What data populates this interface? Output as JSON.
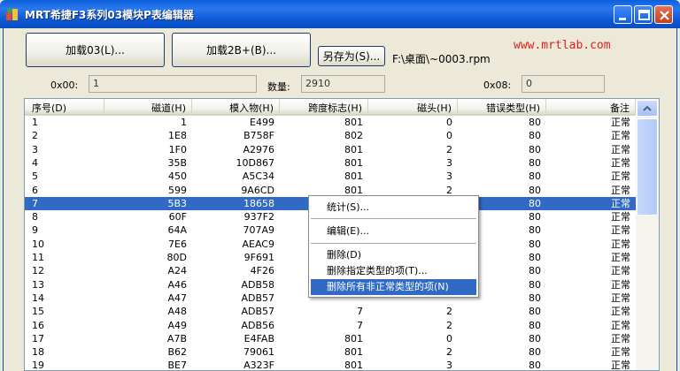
{
  "window": {
    "title": "MRT希捷F3系列03模块P表编辑器"
  },
  "toolbar": {
    "load03_label": "加载03(L)...",
    "load2b_label": "加载2B+(B)...",
    "saveas_label": "另存为(S)...",
    "file_path": "F:\\桌面\\~0003.rpm",
    "site_url": "www.mrtlab.com"
  },
  "info": {
    "x00_label": "0x00:",
    "x00_value": "1",
    "count_label": "数量:",
    "count_value": "2910",
    "x08_label": "0x08:",
    "x08_value": "0"
  },
  "table": {
    "columns": [
      "序号(D)",
      "磁道(H)",
      "模入物(H)",
      "跨度标志(H)",
      "磁头(H)",
      "错误类型(H)",
      "备注"
    ],
    "selected_index": 6,
    "rows": [
      [
        "1",
        "1",
        "E499",
        "801",
        "0",
        "80",
        "正常"
      ],
      [
        "2",
        "1E8",
        "B758F",
        "802",
        "0",
        "80",
        "正常"
      ],
      [
        "3",
        "1F0",
        "A2976",
        "801",
        "2",
        "80",
        "正常"
      ],
      [
        "4",
        "35B",
        "10D867",
        "801",
        "3",
        "80",
        "正常"
      ],
      [
        "5",
        "450",
        "A5C34",
        "801",
        "3",
        "80",
        "正常"
      ],
      [
        "6",
        "599",
        "9A6CD",
        "801",
        "2",
        "80",
        "正常"
      ],
      [
        "7",
        "5B3",
        "18658",
        "",
        "",
        "80",
        "正常"
      ],
      [
        "8",
        "60F",
        "937F2",
        "",
        "",
        "80",
        "正常"
      ],
      [
        "9",
        "64A",
        "707A9",
        "",
        "",
        "80",
        "正常"
      ],
      [
        "10",
        "7E6",
        "AEAC9",
        "",
        "",
        "80",
        "正常"
      ],
      [
        "11",
        "80D",
        "9F691",
        "",
        "",
        "80",
        "正常"
      ],
      [
        "12",
        "A24",
        "4F26",
        "",
        "",
        "80",
        "正常"
      ],
      [
        "13",
        "A46",
        "ADB58",
        "",
        "",
        "80",
        "正常"
      ],
      [
        "14",
        "A47",
        "ADB57",
        "",
        "",
        "80",
        "正常"
      ],
      [
        "15",
        "A48",
        "ADB57",
        "7",
        "2",
        "80",
        "正常"
      ],
      [
        "16",
        "A49",
        "ADB56",
        "7",
        "2",
        "80",
        "正常"
      ],
      [
        "17",
        "A7B",
        "E4FAB",
        "801",
        "0",
        "80",
        "正常"
      ],
      [
        "18",
        "B62",
        "79061",
        "801",
        "2",
        "80",
        "正常"
      ],
      [
        "19",
        "BE7",
        "A323F",
        "801",
        "3",
        "80",
        "正常"
      ]
    ]
  },
  "context_menu": {
    "items": [
      {
        "label": "统计(S)..."
      },
      {
        "label": "编辑(E)..."
      },
      {
        "label": "删除(D)"
      },
      {
        "label": "删除指定类型的项(T)..."
      },
      {
        "label": "删除所有非正常类型的项(N)"
      }
    ]
  },
  "colors": {
    "selection": "#316ac5",
    "title_bar": "#0a5fdc",
    "url_text": "#e02020"
  }
}
